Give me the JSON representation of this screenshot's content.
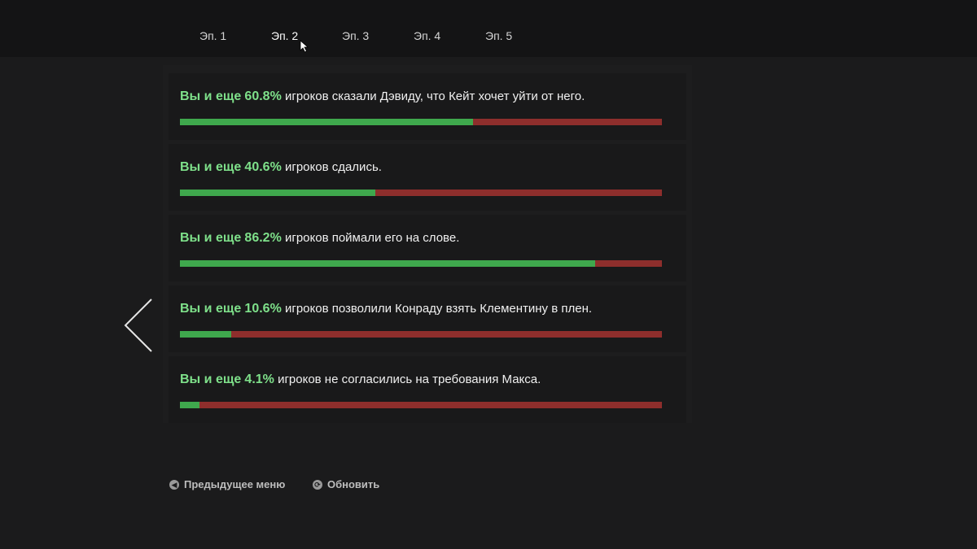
{
  "tabs": [
    {
      "label": "Эп. 1"
    },
    {
      "label": "Эп. 2"
    },
    {
      "label": "Эп. 3"
    },
    {
      "label": "Эп. 4"
    },
    {
      "label": "Эп. 5"
    }
  ],
  "active_tab": 1,
  "choices": [
    {
      "prefix": "Вы и еще",
      "percent": "60.8%",
      "text": "игроков сказали Дэвиду, что Кейт хочет уйти от него.",
      "value": 60.8
    },
    {
      "prefix": "Вы и еще",
      "percent": "40.6%",
      "text": "игроков сдались.",
      "value": 40.6
    },
    {
      "prefix": "Вы и еще",
      "percent": "86.2%",
      "text": "игроков поймали его на слове.",
      "value": 86.2
    },
    {
      "prefix": "Вы и еще",
      "percent": "10.6%",
      "text": "игроков позволили Конраду взять Клементину в плен.",
      "value": 10.6
    },
    {
      "prefix": "Вы и еще",
      "percent": "4.1%",
      "text": "игроков не согласились на требования Макса.",
      "value": 4.1
    }
  ],
  "footer": {
    "back_label": "Предыдущее меню",
    "back_glyph": "◀",
    "refresh_label": "Обновить",
    "refresh_glyph": "⟳"
  },
  "colors": {
    "agree": "#3fa84d",
    "disagree": "#8e2e2c",
    "highlight": "#7ee08a"
  }
}
